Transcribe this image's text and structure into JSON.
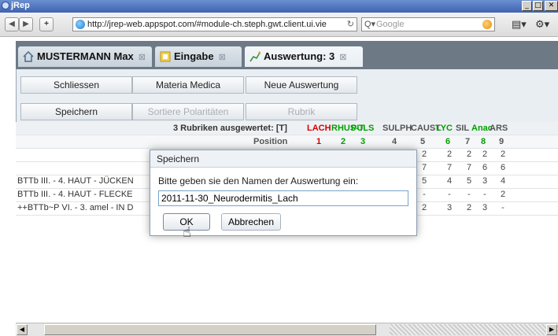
{
  "window": {
    "title": "jRep"
  },
  "browser": {
    "url": "http://jrep-web.appspot.com/#module-ch.steph.gwt.client.ui.vie",
    "search_placeholder": "Google"
  },
  "tabs": [
    {
      "label": "MUSTERMANN Max"
    },
    {
      "label": "Eingabe"
    },
    {
      "label": "Auswertung: 3"
    }
  ],
  "toolbar": {
    "row1": [
      "Schliessen",
      "Materia Medica",
      "Neue Auswertung"
    ],
    "row2": [
      "Speichern",
      "Sortiere Polaritäten",
      "Rubrik"
    ]
  },
  "table": {
    "summary": "3 Rubriken ausgewertet: [T]",
    "position_label": "Position",
    "columns": [
      {
        "name": "LACH",
        "color": "#d40000",
        "pos": "1"
      },
      {
        "name": "RHUS-T",
        "color": "#00a000",
        "pos": "2"
      },
      {
        "name": "PULS",
        "color": "#00a000",
        "pos": "3"
      },
      {
        "name": "SULPH",
        "color": "#555555",
        "pos": "4"
      },
      {
        "name": "CAUST",
        "color": "#555555",
        "pos": "5"
      },
      {
        "name": "LYC",
        "color": "#00a000",
        "pos": "6"
      },
      {
        "name": "SIL",
        "color": "#555555",
        "pos": "7"
      },
      {
        "name": "Anac",
        "color": "#00a000",
        "pos": "8"
      },
      {
        "name": "ARS",
        "color": "#555555",
        "pos": "9"
      }
    ],
    "rows": [
      {
        "label": "",
        "values": [
          "",
          "",
          "",
          "2",
          "2",
          "2",
          "2",
          "2",
          "2"
        ]
      },
      {
        "label": "",
        "values": [
          "",
          "",
          "",
          "8",
          "7",
          "7",
          "7",
          "6",
          "6"
        ]
      },
      {
        "label": "BTTb  III. - 4. HAUT - JÜCKEN",
        "values": [
          "",
          "",
          "",
          "5",
          "5",
          "4",
          "5",
          "3",
          "4"
        ]
      },
      {
        "label": "BTTb  III. - 4. HAUT - FLECKE",
        "values": [
          "",
          "",
          "",
          "-",
          "-",
          "-",
          "-",
          "-",
          "2"
        ]
      },
      {
        "label": "++BTTb~P  VI. - 3. amel - IN D",
        "values": [
          "",
          "",
          "",
          "3",
          "2",
          "3",
          "2",
          "3",
          "-"
        ]
      }
    ]
  },
  "dialog": {
    "title": "Speichern",
    "message": "Bitte geben sie den Namen der Auswertung ein:",
    "value": "2011-11-30_Neurodermitis_Lach",
    "ok": "OK",
    "cancel": "Abbrechen"
  }
}
